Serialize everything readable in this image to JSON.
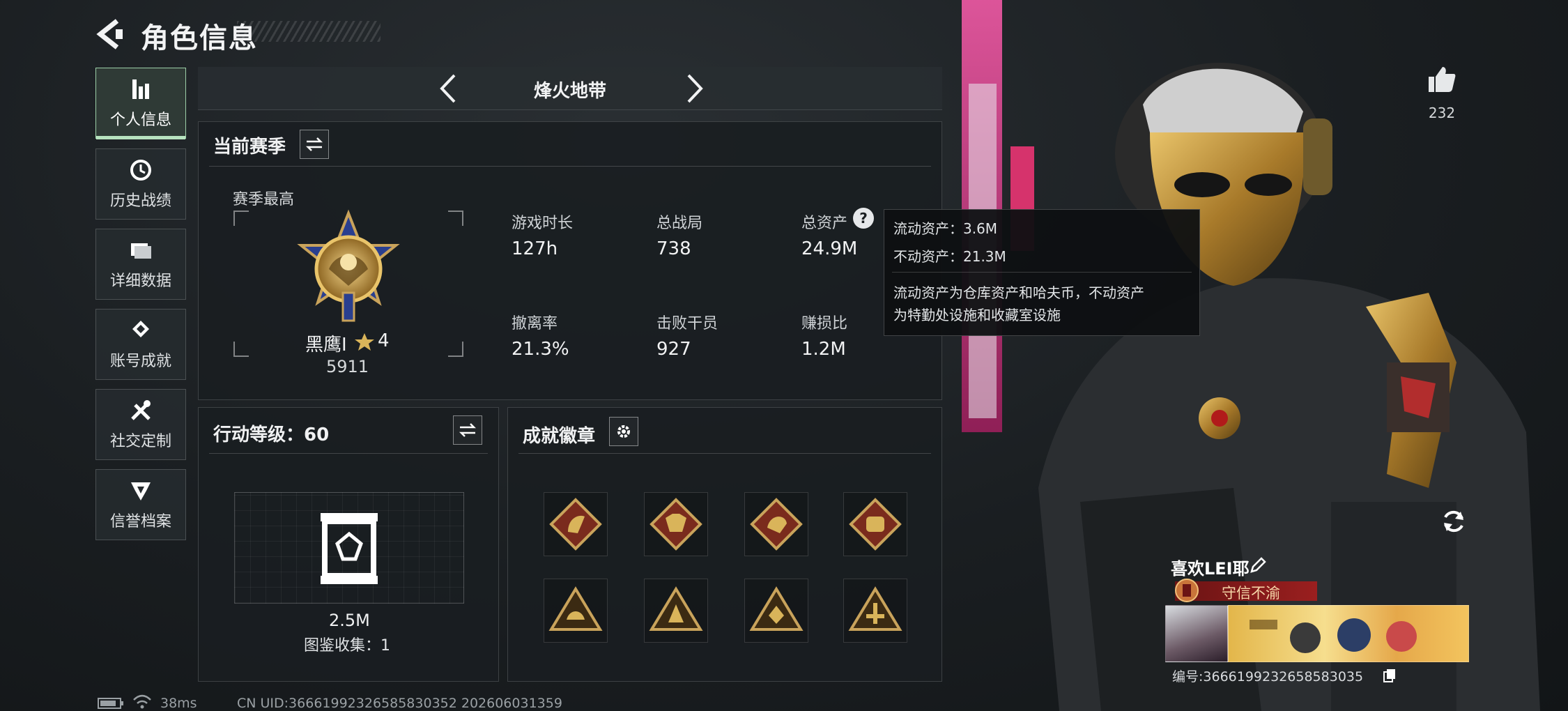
{
  "header": {
    "title": "角色信息"
  },
  "sidebar": {
    "items": [
      {
        "label": "个人信息",
        "icon": "bar-chart-icon",
        "active": true
      },
      {
        "label": "历史战绩",
        "icon": "history-clock-icon",
        "active": false
      },
      {
        "label": "详细数据",
        "icon": "folder-icon",
        "active": false
      },
      {
        "label": "账号成就",
        "icon": "achievement-icon",
        "active": false
      },
      {
        "label": "社交定制",
        "icon": "tools-icon",
        "active": false
      },
      {
        "label": "信誉档案",
        "icon": "reputation-icon",
        "active": false
      }
    ]
  },
  "mode": {
    "name": "烽火地带"
  },
  "season": {
    "title": "当前赛季",
    "best_label": "赛季最高",
    "rank_name": "黑鹰I",
    "rank_stars": "4",
    "rank_score": "5911",
    "stats": [
      {
        "label": "游戏时长",
        "value": "127h"
      },
      {
        "label": "总战局",
        "value": "738"
      },
      {
        "label": "总资产",
        "value": "24.9M"
      },
      {
        "label": "撤离率",
        "value": "21.3%"
      },
      {
        "label": "击败干员",
        "value": "927"
      },
      {
        "label": "赚损比",
        "value": "1.2M"
      }
    ]
  },
  "tooltip": {
    "line1": "流动资产：3.6M",
    "line2": "不动资产：21.3M",
    "desc1": "流动资产为仓库资产和哈夫币，不动资产",
    "desc2": "为特勤处设施和收藏室设施"
  },
  "action_level": {
    "title": "行动等级：60",
    "value": "2.5M",
    "collection": "图鉴收集：1"
  },
  "badges": {
    "title": "成就徽章",
    "row1": [
      "horse-badge-icon",
      "wolf-badge-icon",
      "dragon-badge-icon",
      "fist-badge-icon"
    ],
    "row2": [
      "triangle-badge-icon",
      "triangle-badge-icon",
      "triangle-badge-icon",
      "triangle-badge-icon"
    ]
  },
  "likes": {
    "count": "232"
  },
  "profile": {
    "name": "喜欢LEI耶",
    "title_badge": "守信不渝",
    "uid": "编号:3666199232658583035"
  },
  "status_bar": {
    "ping": "38ms",
    "uid": "CN UID:3666199232658583035​2  202606031359"
  },
  "colors": {
    "accent": "#b7e3bf",
    "badge_gold": "#c9a35b",
    "title_red": "#9a1f1f"
  }
}
